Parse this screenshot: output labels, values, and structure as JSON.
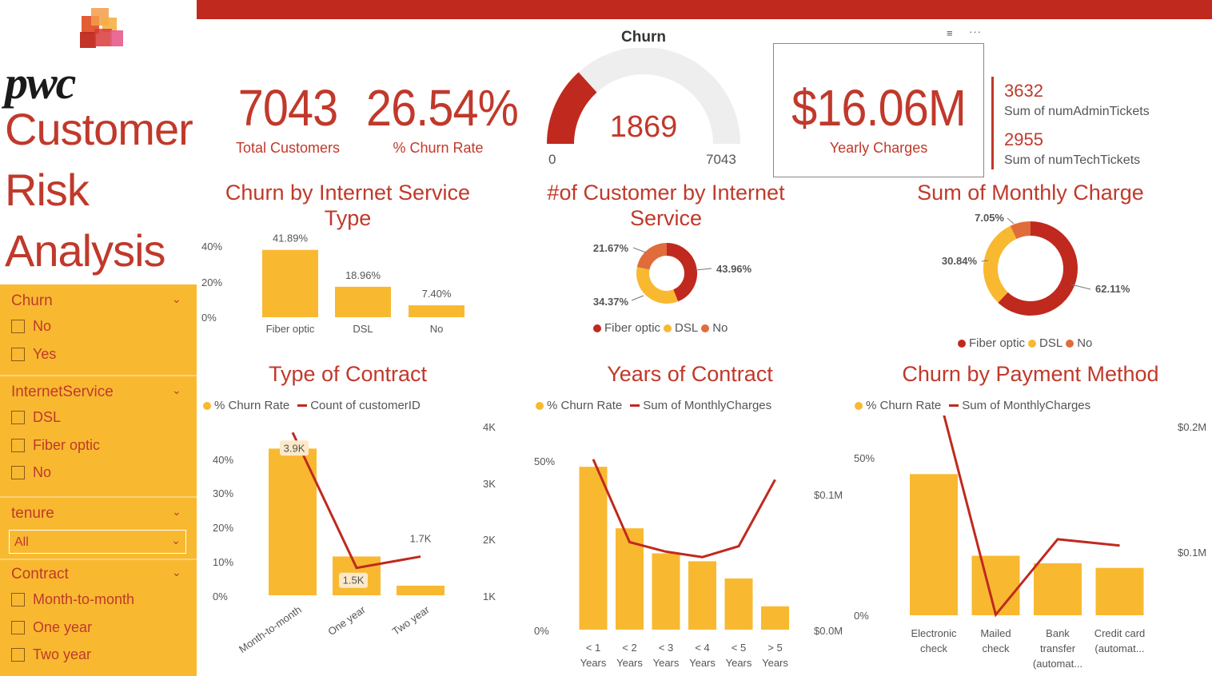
{
  "colors": {
    "red": "#c0291e",
    "yellow": "#f8b931",
    "orange": "#e06c3c",
    "gray": "#eeeeee"
  },
  "header": {
    "logo_icon": "pwc-logo-icon",
    "logo_text": "pwc",
    "title_lines": [
      "Customer",
      "Risk",
      "Analysis"
    ]
  },
  "filters": {
    "churn": {
      "label": "Churn",
      "options": [
        "No",
        "Yes"
      ]
    },
    "internet": {
      "label": "InternetService",
      "options": [
        "DSL",
        "Fiber optic",
        "No"
      ]
    },
    "tenure": {
      "label": "tenure",
      "value": "All"
    },
    "contract": {
      "label": "Contract",
      "options": [
        "Month-to-month",
        "One year",
        "Two year"
      ]
    }
  },
  "kpis": {
    "total_customers": {
      "value": "7043",
      "label": "Total Customers"
    },
    "churn_rate": {
      "value": "26.54%",
      "label": "% Churn Rate"
    },
    "yearly_charges": {
      "value": "$16.06M",
      "label": "Yearly Charges"
    },
    "admin_tickets": {
      "value": "3632",
      "label": "Sum of numAdminTickets"
    },
    "tech_tickets": {
      "value": "2955",
      "label": "Sum of numTechTickets"
    }
  },
  "gauge": {
    "title": "Churn",
    "value": 1869,
    "value_label": "1869",
    "min_label": "0",
    "max_label": "7043",
    "max": 7043
  },
  "toolbar": {
    "filter_icon": "filter-icon",
    "more_icon": "more-options-icon"
  },
  "chart_data": [
    {
      "id": "churn_internet",
      "type": "bar",
      "title": "Churn by Internet Service Type",
      "categories": [
        "Fiber optic",
        "DSL",
        "No"
      ],
      "values": [
        41.89,
        18.96,
        7.4
      ],
      "labels": [
        "41.89%",
        "18.96%",
        "7.40%"
      ],
      "y_ticks": [
        "40%",
        "20%",
        "0%"
      ],
      "ylim": [
        0,
        45
      ]
    },
    {
      "id": "cust_internet",
      "type": "pie",
      "title": "#of Customer by Internet Service",
      "categories": [
        "Fiber optic",
        "DSL",
        "No"
      ],
      "values": [
        43.96,
        34.37,
        21.67
      ],
      "labels": [
        "43.96%",
        "34.37%",
        "21.67%"
      ]
    },
    {
      "id": "monthly_charge",
      "type": "pie",
      "title": "Sum of Monthly Charge",
      "categories": [
        "Fiber optic",
        "DSL",
        "No"
      ],
      "values": [
        62.11,
        30.84,
        7.05
      ],
      "labels": [
        "62.11%",
        "30.84%",
        "7.05%"
      ]
    },
    {
      "id": "contract",
      "type": "bar",
      "title": "Type of Contract",
      "legend": [
        "% Churn Rate",
        "Count of customerID"
      ],
      "categories": [
        "Month-to-month",
        "One year",
        "Two year"
      ],
      "bar_values": [
        42.7,
        11.3,
        2.8
      ],
      "line_values": [
        3.9,
        1.5,
        1.7
      ],
      "line_labels": [
        "3.9K",
        "1.5K",
        "1.7K"
      ],
      "y_ticks": [
        "40%",
        "30%",
        "20%",
        "10%",
        "0%"
      ],
      "y2_ticks": [
        "4K",
        "3K",
        "2K",
        "1K"
      ]
    },
    {
      "id": "years",
      "type": "bar",
      "title": "Years of Contract",
      "legend": [
        "% Churn Rate",
        "Sum of MonthlyCharges"
      ],
      "categories": [
        [
          "< 1",
          "Years"
        ],
        [
          "< 2",
          "Years"
        ],
        [
          "< 3",
          "Years"
        ],
        [
          "< 4",
          "Years"
        ],
        [
          "< 5",
          "Years"
        ],
        [
          "> 5",
          "Years"
        ]
      ],
      "bar_values": [
        47.4,
        29.5,
        22.2,
        19.9,
        14.9,
        6.8
      ],
      "line_values": [
        0.126,
        0.065,
        0.058,
        0.054,
        0.062,
        0.111
      ],
      "y_ticks": [
        "50%",
        "0%"
      ],
      "y2_ticks": [
        "$0.1M",
        "$0.0M"
      ]
    },
    {
      "id": "payment",
      "type": "bar",
      "title": "Churn by Payment Method",
      "legend": [
        "% Churn Rate",
        "Sum of MonthlyCharges"
      ],
      "categories": [
        [
          "Electronic",
          "check"
        ],
        [
          "Mailed",
          "check"
        ],
        [
          "Bank",
          "transfer",
          "(automat..."
        ],
        [
          "Credit card",
          "(automat..."
        ]
      ],
      "bar_values": [
        45.3,
        19.1,
        16.7,
        15.2
      ],
      "line_values": [
        0.24,
        0.05,
        0.11,
        0.105
      ],
      "y_ticks": [
        "50%",
        "0%"
      ],
      "y2_ticks": [
        "$0.2M",
        "$0.1M"
      ]
    }
  ]
}
